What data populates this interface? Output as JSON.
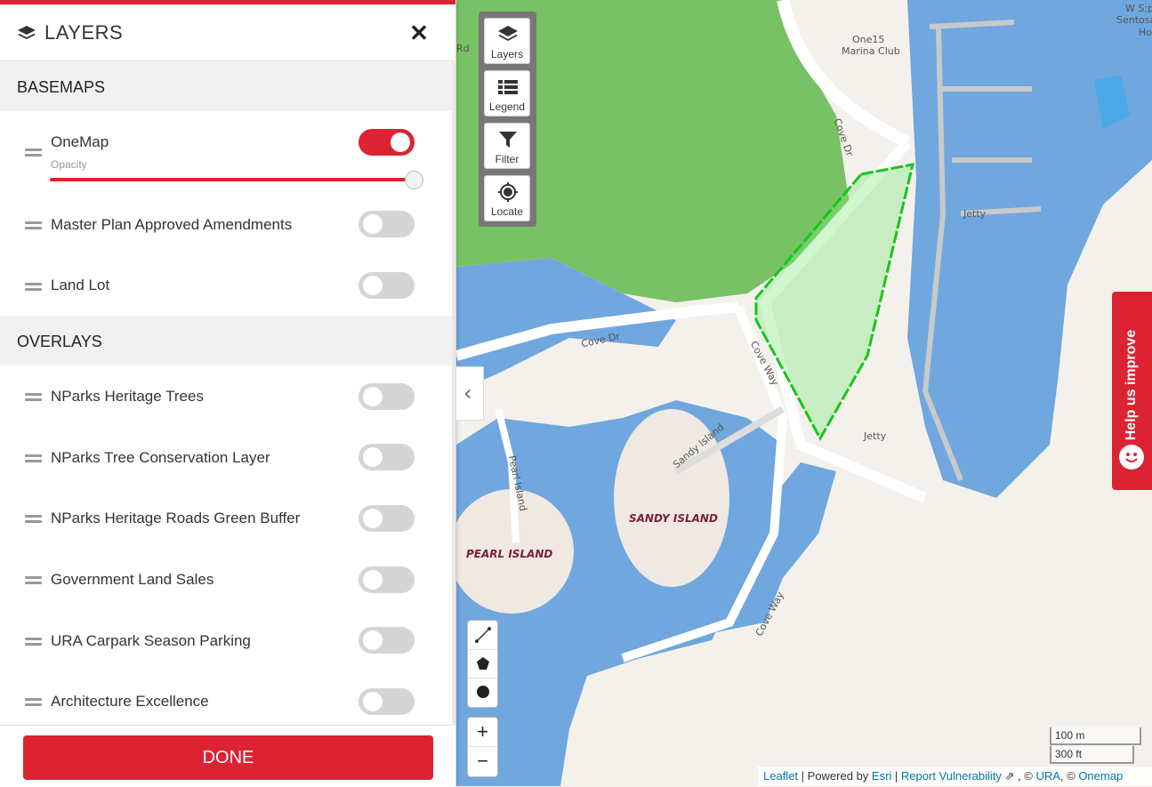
{
  "panel": {
    "title": "LAYERS",
    "close_icon": "✕",
    "basemaps_heading": "BASEMAPS",
    "overlays_heading": "OVERLAYS",
    "opacity_label": "Opacity",
    "opacity_value": 1.0,
    "basemaps": [
      {
        "label": "OneMap",
        "on": true
      },
      {
        "label": "Master Plan Approved Amendments",
        "on": false
      },
      {
        "label": "Land Lot",
        "on": false
      }
    ],
    "overlays": [
      {
        "label": "NParks Heritage Trees",
        "on": false
      },
      {
        "label": "NParks Tree Conservation Layer",
        "on": false
      },
      {
        "label": "NParks Heritage Roads Green Buffer",
        "on": false
      },
      {
        "label": "Government Land Sales",
        "on": false
      },
      {
        "label": "URA Carpark Season Parking",
        "on": false
      },
      {
        "label": "Architecture Excellence",
        "on": false
      }
    ],
    "done_label": "DONE"
  },
  "toolbar": {
    "layers": "Layers",
    "legend": "Legend",
    "filter": "Filter",
    "locate": "Locate"
  },
  "zoom": {
    "in": "+",
    "out": "−"
  },
  "help": {
    "label": "Help us improve"
  },
  "scale": {
    "metric": "100 m",
    "imperial": "300 ft"
  },
  "attribution": {
    "leaflet": "Leaflet",
    "powered": " | Powered by ",
    "esri": "Esri",
    "sep": " | ",
    "report": "Report Vulnerability",
    "copy_ura": " , © ",
    "ura": "URA",
    "copy_onemap": ", © ",
    "onemap": "Onemap"
  },
  "map_labels": {
    "rd": "Rd",
    "one15": "One15",
    "marina_club": "Marina Club",
    "ws": "W S;p",
    "sentosa": "Sentosa",
    "ho": "Ho",
    "cove_dr_1": "Cove Dr",
    "cove_dr_2": "Cove Dr",
    "cove_way_1": "Cove Way",
    "cove_way_2": "Cove Way",
    "jetty_1": "Jetty",
    "jetty_2": "Jetty",
    "sandy_island_road": "Sandy Island",
    "pearl_island_road": "Pearl Island",
    "sandy_island": "SANDY ISLAND",
    "pearl_island": "PEARL ISLAND"
  }
}
